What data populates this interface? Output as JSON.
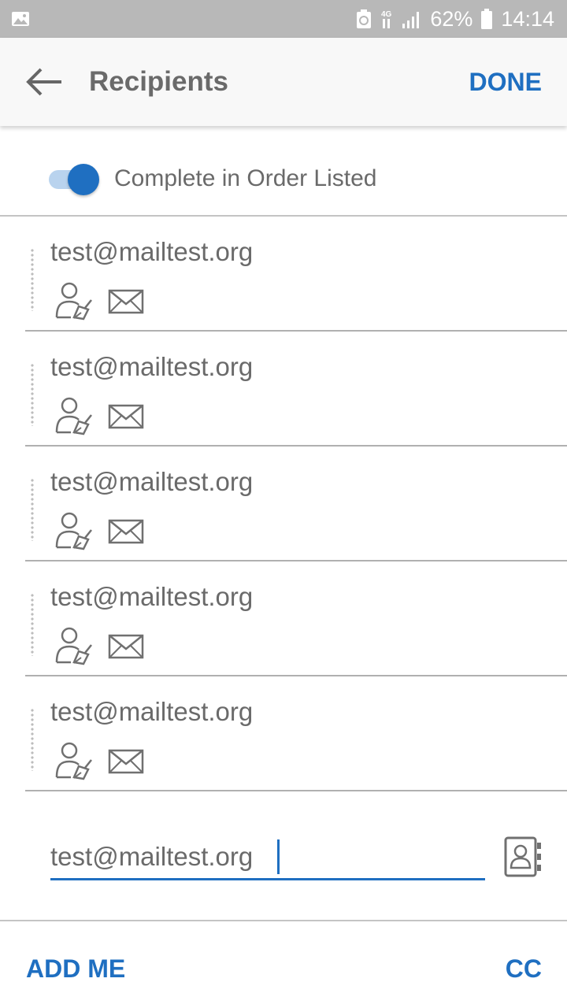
{
  "status_bar": {
    "battery_percent": "62%",
    "time": "14:14",
    "icons": [
      "gallery-icon",
      "recycle-notification-icon",
      "network-4g-icon",
      "signal-icon",
      "battery-icon"
    ]
  },
  "header": {
    "title": "Recipients",
    "done_label": "DONE",
    "icons": [
      "back-arrow-icon"
    ]
  },
  "order": {
    "label": "Complete in Order Listed",
    "enabled": true
  },
  "recipients": [
    {
      "email": "test@mailtest.org",
      "icons": [
        "signer-icon",
        "email-delivery-icon"
      ]
    },
    {
      "email": "test@mailtest.org",
      "icons": [
        "signer-icon",
        "email-delivery-icon"
      ]
    },
    {
      "email": "test@mailtest.org",
      "icons": [
        "signer-icon",
        "email-delivery-icon"
      ]
    },
    {
      "email": "test@mailtest.org",
      "icons": [
        "signer-icon",
        "email-delivery-icon"
      ]
    },
    {
      "email": "test@mailtest.org",
      "icons": [
        "signer-icon",
        "email-delivery-icon"
      ]
    }
  ],
  "new_recipient": {
    "value": "test@mailtest.org",
    "icons": [
      "contacts-book-icon"
    ]
  },
  "footer": {
    "add_me_label": "ADD ME",
    "cc_label": "CC"
  },
  "colors": {
    "accent": "#1f6fc1",
    "status_bar": "#b8b8b8",
    "text": "#6a6a6a",
    "divider": "#b0b0b0"
  }
}
